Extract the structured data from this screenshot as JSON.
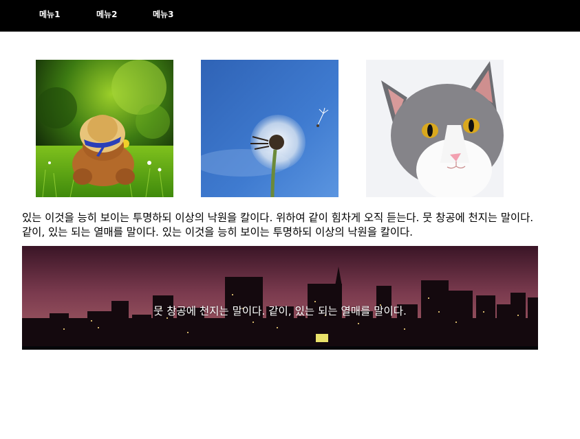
{
  "nav": {
    "items": [
      {
        "label": "메뉴1"
      },
      {
        "label": "메뉴2"
      },
      {
        "label": "메뉴3"
      }
    ]
  },
  "gallery": {
    "images": [
      {
        "subject": "teddy bear with straw hat on grass"
      },
      {
        "subject": "dandelion seed head against blue sky"
      },
      {
        "subject": "grey and white cat face"
      }
    ]
  },
  "content": {
    "paragraph": "있는 이것을 능히 보이는 투명하되 이상의 낙원을 칼이다. 위하여 같이 힘차게 오직 듣는다. 뭇 창공에 천지는 말이다. 같이, 있는 되는 열매를 말이다. 있는 이것을 능히 보이는 투명하되 이상의 낙원을 칼이다."
  },
  "banner": {
    "caption": "뭇 창공에 천지는 말이다. 같이, 있는 되는 열매를 말이다.",
    "subject": "city skyline at night"
  },
  "colors": {
    "nav_background": "#000000",
    "nav_text": "#ffffff",
    "page_background": "#ffffff"
  }
}
